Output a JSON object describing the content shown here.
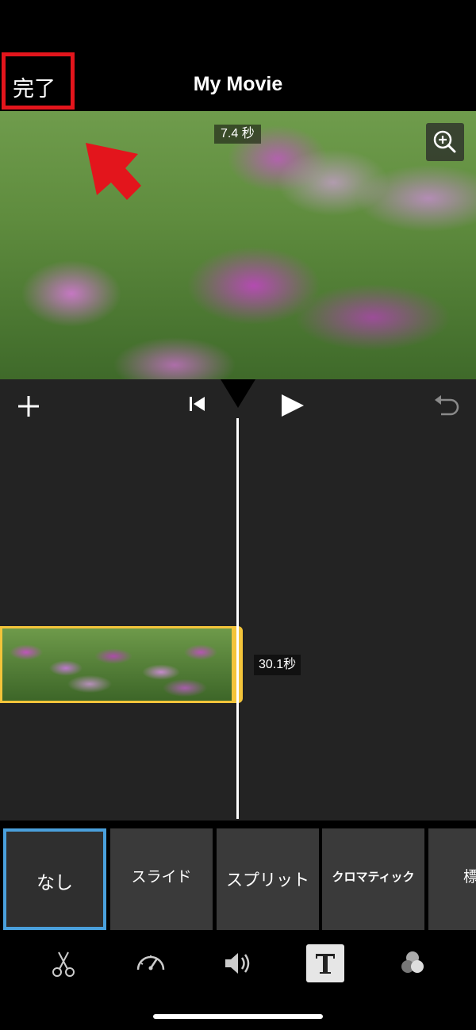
{
  "header": {
    "done_label": "完了",
    "title": "My Movie"
  },
  "preview": {
    "duration_badge": "7.4 秒",
    "zoom_icon": "zoom-in-icon"
  },
  "controls": {
    "add_icon": "plus-icon",
    "skip_back_icon": "skip-to-start-icon",
    "play_icon": "play-icon",
    "undo_icon": "undo-icon"
  },
  "timeline": {
    "clip_duration": "30.1秒"
  },
  "transitions": [
    {
      "label": "なし",
      "selected": true
    },
    {
      "label": "スライド",
      "selected": false
    },
    {
      "label": "スプリット",
      "selected": false
    },
    {
      "label": "クロマティック",
      "selected": false
    },
    {
      "label": "標",
      "selected": false
    }
  ],
  "toolbar": [
    "scissors-icon",
    "speed-icon",
    "volume-icon",
    "text-icon",
    "filters-icon"
  ],
  "colors": {
    "accent_blue": "#4aa0dc",
    "clip_yellow": "#f3c43a",
    "annotation_red": "#e3151c"
  }
}
